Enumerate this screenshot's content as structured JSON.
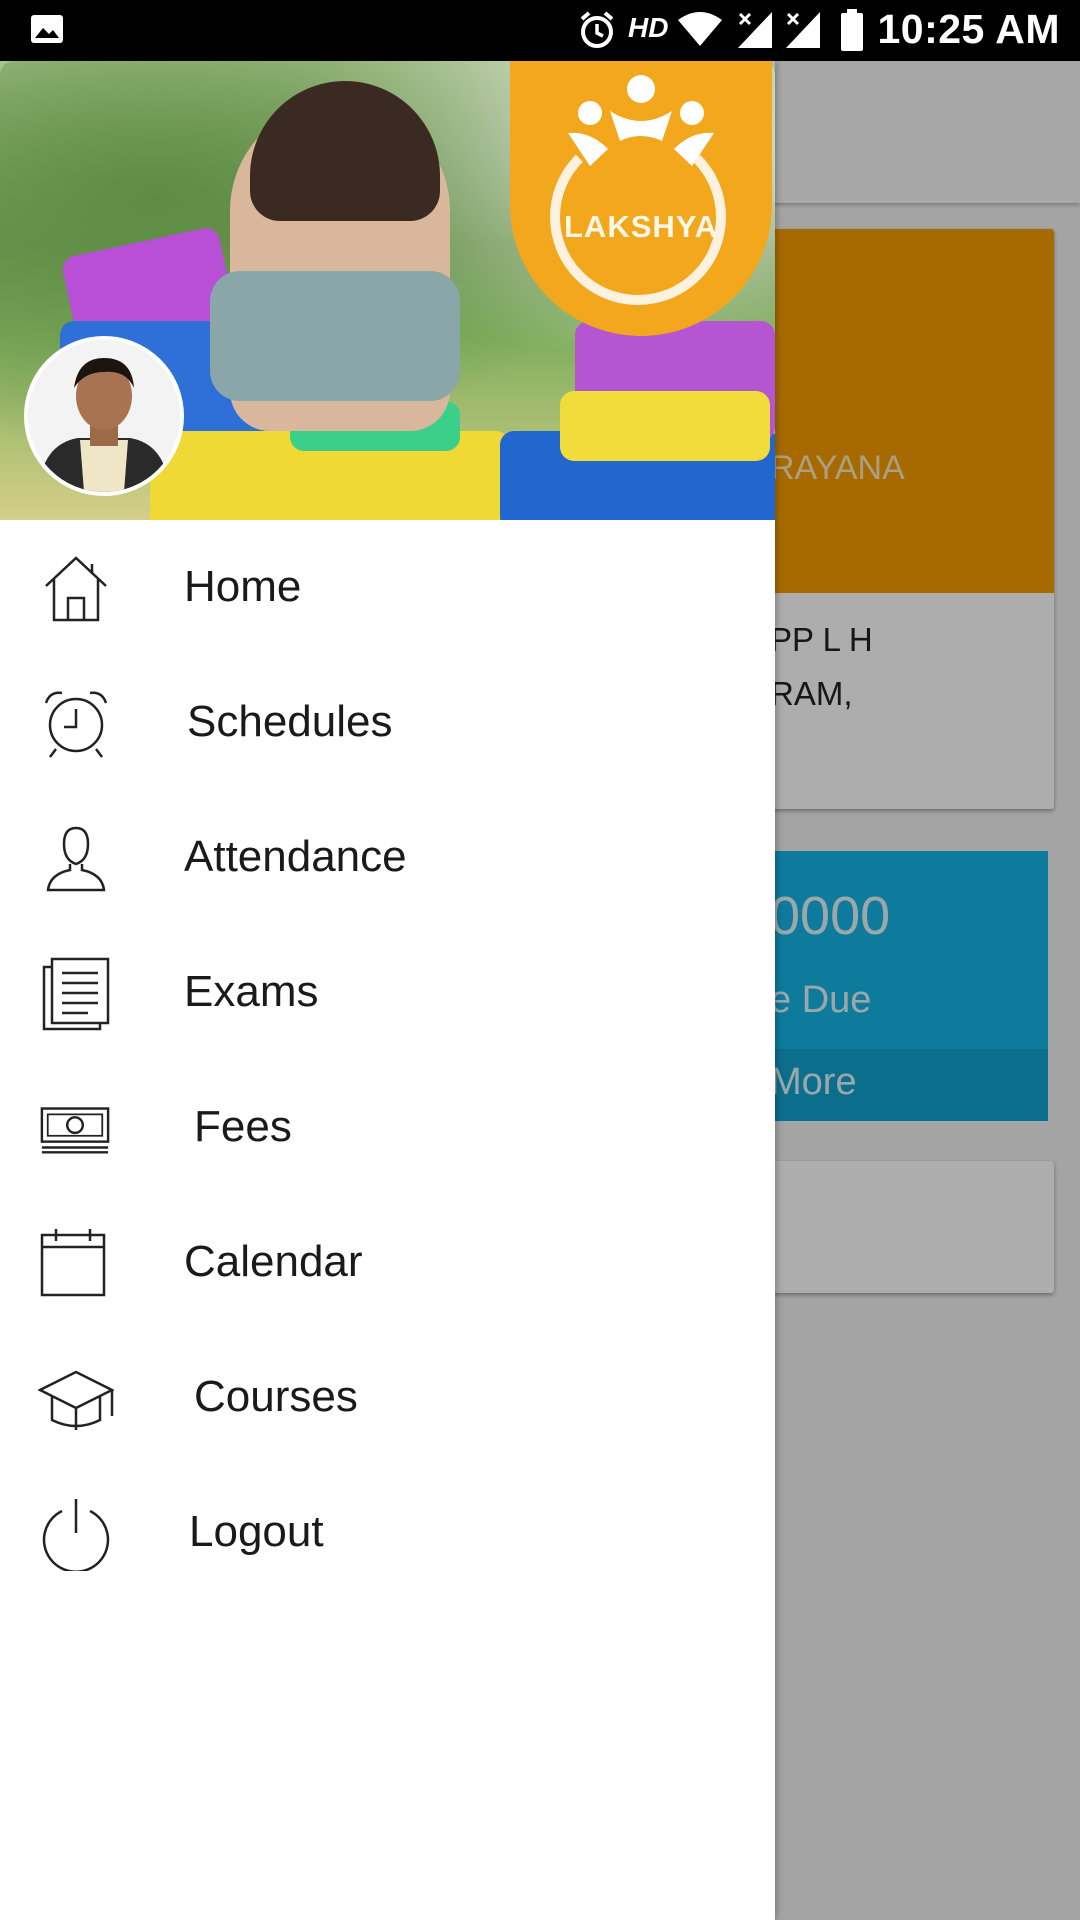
{
  "status_bar": {
    "time": "10:25 AM",
    "hd_label": "HD",
    "icons": [
      "image-icon",
      "alarm-icon",
      "wifi-icon",
      "signal-icon",
      "signal-icon",
      "battery-icon"
    ]
  },
  "drawer": {
    "header": {
      "logo_text": "LAKSHYA"
    },
    "items": [
      {
        "label": "Home",
        "icon": "home-icon"
      },
      {
        "label": "Schedules",
        "icon": "alarm-clock-icon"
      },
      {
        "label": "Attendance",
        "icon": "person-icon"
      },
      {
        "label": "Exams",
        "icon": "document-icon"
      },
      {
        "label": "Fees",
        "icon": "money-icon"
      },
      {
        "label": "Calendar",
        "icon": "calendar-icon"
      },
      {
        "label": "Courses",
        "icon": "graduation-cap-icon"
      },
      {
        "label": "Logout",
        "icon": "power-icon"
      }
    ]
  },
  "background": {
    "student_name_fragment": "RAYANA",
    "address_line1": "PP L H",
    "address_line2": "RAM,",
    "fee_amount_fragment": "0000",
    "fee_label_fragment": "e Due",
    "more_label_fragment": "More"
  },
  "colors": {
    "accent_orange": "#f59d00",
    "accent_blue": "#16b6e6",
    "logo_orange": "#f2a71c"
  }
}
